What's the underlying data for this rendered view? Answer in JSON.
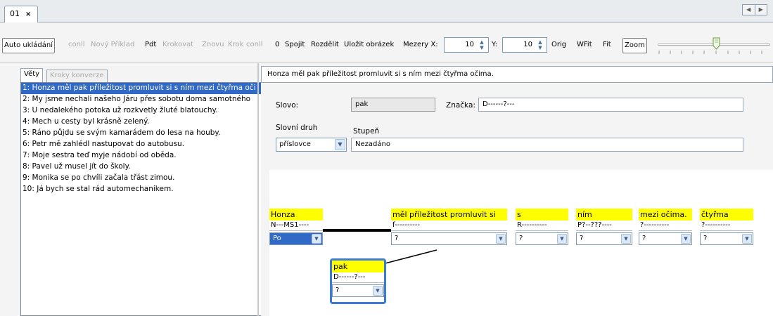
{
  "tabs": [
    {
      "label": "01",
      "close": "×"
    }
  ],
  "nav_arrows": {
    "left": "◀",
    "right": "▶"
  },
  "toolbar": {
    "auto_save": "Auto ukládání",
    "conll1": "conll",
    "new_example": "Nový Příklad",
    "pdt": "Pdt",
    "step": "Krokovat",
    "again": "Znovu",
    "step2": "Krok",
    "conll2": "conll",
    "zero": "0",
    "join": "Spojit",
    "split": "Rozdělit",
    "save_image": "Uložit obrázek",
    "spacing_x_label": "Mezery X:",
    "spacing_x_value": "10",
    "spacing_y_label": "Y:",
    "spacing_y_value": "10",
    "orig": "Orig",
    "wfit": "WFit",
    "fit": "Fit",
    "zoom": "Zoom",
    "zoom_level_percent": 50
  },
  "left_panel": {
    "tabs": [
      "Věty",
      "Kroky konverze"
    ],
    "sentences": [
      "1: Honza měl pak příležitost promluvit si s ním mezi čtyřma oči",
      "2: My jsme nechali našeho Járu přes sobotu doma samotného",
      "3: U nedalekého potoka už rozkvetly žluté blatouchy.",
      "4: Mech u cesty byl krásně zelený.",
      "5: Ráno půjdu se svým kamarádem do lesa na houby.",
      "6: Petr mě zahlédl nastupovat do autobusu.",
      "7: Moje sestra teď myje nádobí od oběda.",
      "8: Pavel už musel jít do školy.",
      "9: Monika se po chvíli začala třást zimou.",
      "10: Já bych se stal rád automechanikem."
    ],
    "selected_index": 0
  },
  "right_panel": {
    "sentence": "Honza měl pak příležitost promluvit si s ním mezi čtyřma očima.",
    "word_label": "Slovo:",
    "word_value": "pak",
    "tag_label": "Značka:",
    "tag_value": "D------?---",
    "pos_label": "Slovní druh",
    "pos_value": "příslovce",
    "degree_label": "Stupeň",
    "degree_value": "Nezadáno"
  },
  "tree_nodes": [
    {
      "word": "Honza",
      "tag": "N---MS1----",
      "func": "Po"
    },
    {
      "word": "měl příležitost promluvit si",
      "tag": "f----------",
      "func": "?"
    },
    {
      "word": "s",
      "tag": "R----------",
      "func": "?"
    },
    {
      "word": "ním",
      "tag": "P?--???----",
      "func": "?"
    },
    {
      "word": "mezi očima.",
      "tag": "?----------",
      "func": "?"
    },
    {
      "word": "čtyřma",
      "tag": "?----------",
      "func": "?"
    },
    {
      "word": "pak",
      "tag": "D------?---",
      "func": "?"
    }
  ],
  "colors": {
    "node_title": "#ffff00",
    "selection": "#3169c6",
    "focus_border": "#3a7bd5"
  }
}
